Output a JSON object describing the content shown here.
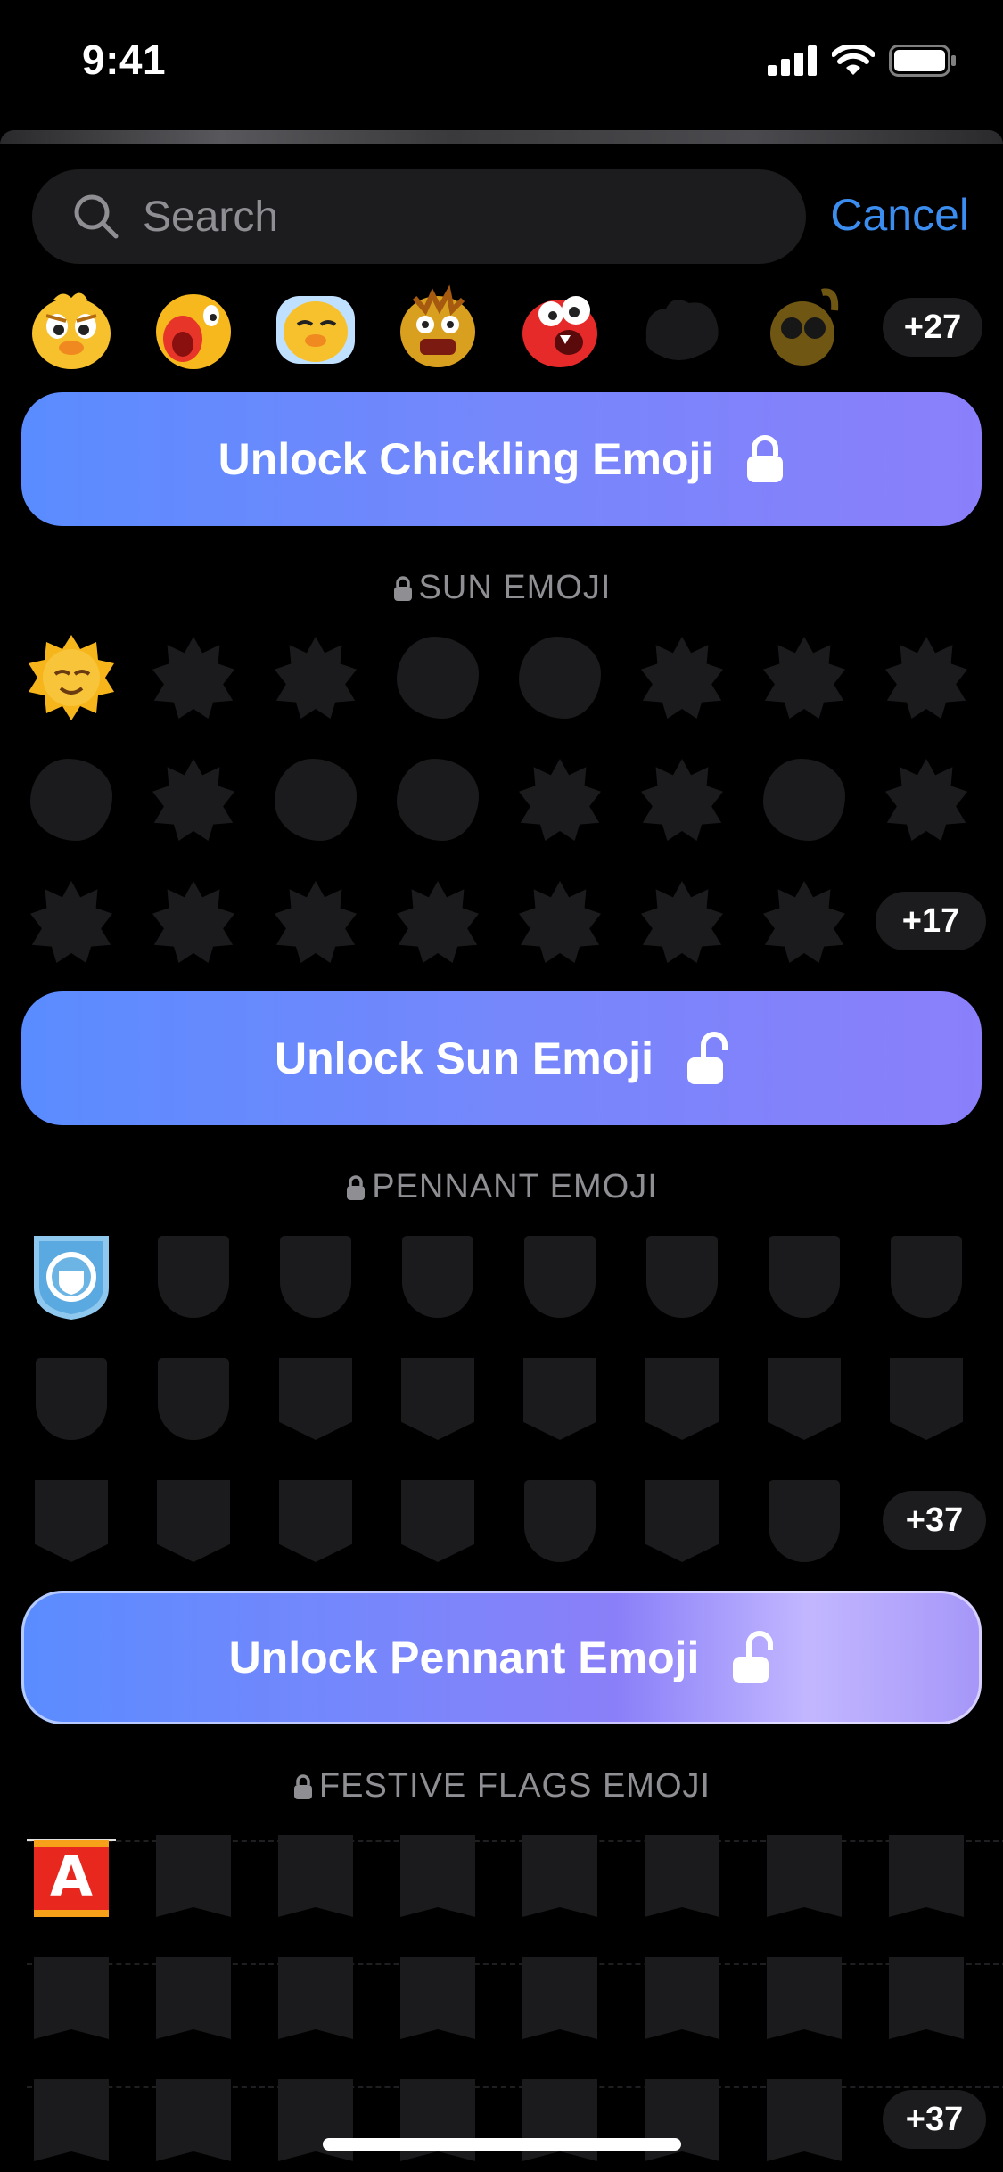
{
  "status_bar": {
    "time": "9:41"
  },
  "search": {
    "placeholder": "Search",
    "cancel_label": "Cancel"
  },
  "chickling": {
    "more_count": "+27",
    "unlock_label": "Unlock Chickling Emoji"
  },
  "sun": {
    "header": "SUN EMOJI",
    "more_count": "+17",
    "unlock_label": "Unlock Sun Emoji"
  },
  "pennant": {
    "header": "PENNANT EMOJI",
    "more_count": "+37",
    "unlock_label": "Unlock Pennant Emoji"
  },
  "festive": {
    "header": "FESTIVE FLAGS EMOJI",
    "more_count": "+37",
    "flag_letter": "A"
  },
  "colors": {
    "accent": "#3b8ef0",
    "button_start": "#5a8cff",
    "button_end": "#8b7ffb",
    "silhouette": "#1b1b1d"
  }
}
